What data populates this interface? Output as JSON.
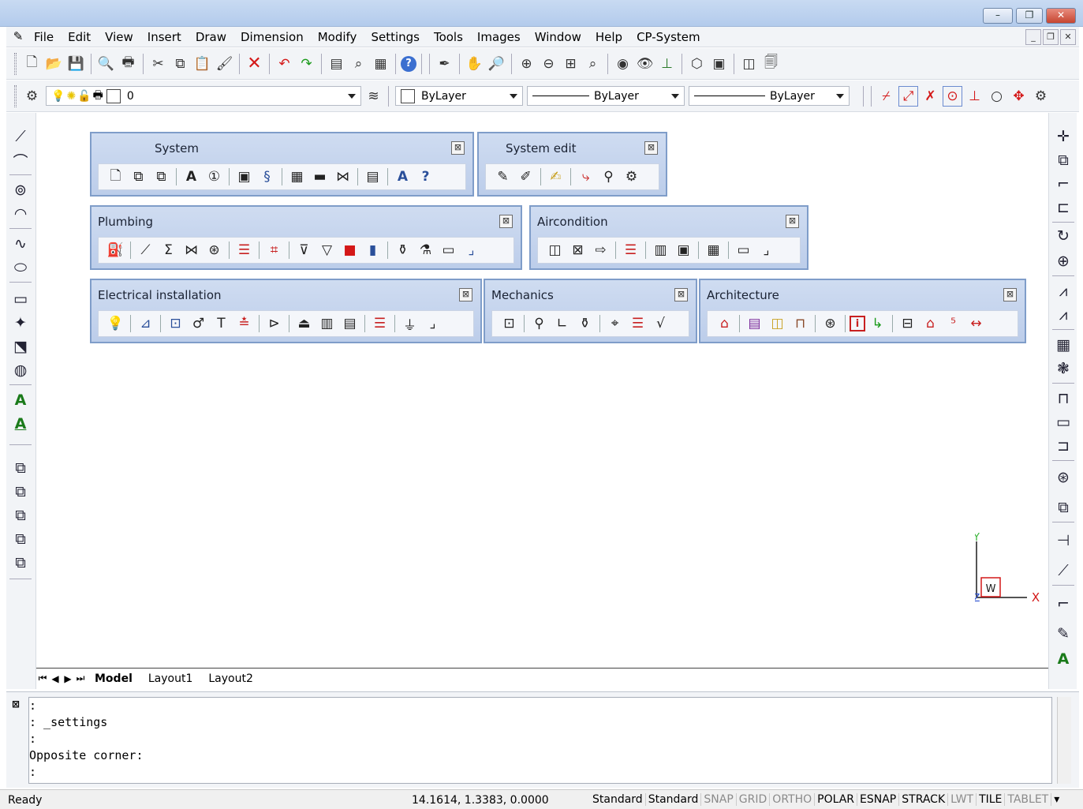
{
  "window": {
    "minimize": "–",
    "restore": "❐",
    "close": "✕"
  },
  "menu": [
    "File",
    "Edit",
    "View",
    "Insert",
    "Draw",
    "Dimension",
    "Modify",
    "Settings",
    "Tools",
    "Images",
    "Window",
    "Help",
    "CP-System"
  ],
  "doc_buttons": [
    "_",
    "❐",
    "✕"
  ],
  "properties": {
    "layer": "0",
    "color": "ByLayer",
    "linetype": "ByLayer",
    "lineweight": "ByLayer"
  },
  "panels": {
    "system": {
      "title": "System"
    },
    "system_edit": {
      "title": "System edit"
    },
    "plumbing": {
      "title": "Plumbing"
    },
    "aircondition": {
      "title": "Aircondition"
    },
    "electrical": {
      "title": "Electrical installation"
    },
    "mechanics": {
      "title": "Mechanics"
    },
    "architecture": {
      "title": "Architecture"
    }
  },
  "ucs": {
    "x_label": "X",
    "y_label": "Y",
    "z_label": "Z",
    "w_label": "W"
  },
  "tabs": {
    "model": "Model",
    "layout1": "Layout1",
    "layout2": "Layout2"
  },
  "command": {
    "lines": [
      ":",
      ": _settings",
      ":",
      "Opposite corner:",
      ":"
    ]
  },
  "status": {
    "ready": "Ready",
    "coords": "14.1614, 1.3383, 0.0000",
    "modes": [
      {
        "label": "Standard",
        "on": true
      },
      {
        "label": "Standard",
        "on": true
      },
      {
        "label": "SNAP",
        "on": false
      },
      {
        "label": "GRID",
        "on": false
      },
      {
        "label": "ORTHO",
        "on": false
      },
      {
        "label": "POLAR",
        "on": true
      },
      {
        "label": "ESNAP",
        "on": true
      },
      {
        "label": "STRACK",
        "on": true
      },
      {
        "label": "LWT",
        "on": false
      },
      {
        "label": "TILE",
        "on": true
      },
      {
        "label": "TABLET",
        "on": false
      }
    ]
  }
}
